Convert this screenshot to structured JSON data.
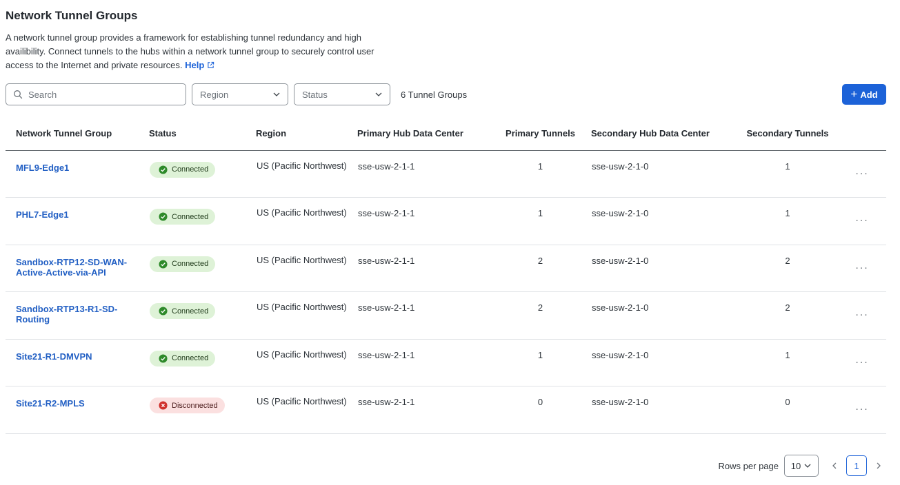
{
  "page": {
    "title": "Network Tunnel Groups",
    "description": "A network tunnel group provides a framework for establishing tunnel redundancy and high availibility. Connect tunnels to the hubs within a network tunnel group to securely control user access to the Internet and private resources.",
    "help_label": "Help"
  },
  "toolbar": {
    "search_placeholder": "Search",
    "region_placeholder": "Region",
    "status_placeholder": "Status",
    "count": "6 Tunnel Groups",
    "add_label": "Add"
  },
  "table": {
    "columns": [
      "Network Tunnel Group",
      "Status",
      "Region",
      "Primary Hub Data Center",
      "Primary Tunnels",
      "Secondary Hub Data Center",
      "Secondary Tunnels"
    ],
    "rows": [
      {
        "name": "MFL9-Edge1",
        "status": "Connected",
        "region": "US (Pacific Northwest)",
        "primary_hub": "sse-usw-2-1-1",
        "primary_tunnels": "1",
        "secondary_hub": "sse-usw-2-1-0",
        "secondary_tunnels": "1"
      },
      {
        "name": "PHL7-Edge1",
        "status": "Connected",
        "region": "US (Pacific Northwest)",
        "primary_hub": "sse-usw-2-1-1",
        "primary_tunnels": "1",
        "secondary_hub": "sse-usw-2-1-0",
        "secondary_tunnels": "1"
      },
      {
        "name": "Sandbox-RTP12-SD-WAN-Active-Active-via-API",
        "status": "Connected",
        "region": "US (Pacific Northwest)",
        "primary_hub": "sse-usw-2-1-1",
        "primary_tunnels": "2",
        "secondary_hub": "sse-usw-2-1-0",
        "secondary_tunnels": "2"
      },
      {
        "name": "Sandbox-RTP13-R1-SD-Routing",
        "status": "Connected",
        "region": "US (Pacific Northwest)",
        "primary_hub": "sse-usw-2-1-1",
        "primary_tunnels": "2",
        "secondary_hub": "sse-usw-2-1-0",
        "secondary_tunnels": "2"
      },
      {
        "name": "Site21-R1-DMVPN",
        "status": "Connected",
        "region": "US (Pacific Northwest)",
        "primary_hub": "sse-usw-2-1-1",
        "primary_tunnels": "1",
        "secondary_hub": "sse-usw-2-1-0",
        "secondary_tunnels": "1"
      },
      {
        "name": "Site21-R2-MPLS",
        "status": "Disconnected",
        "region": "US (Pacific Northwest)",
        "primary_hub": "sse-usw-2-1-1",
        "primary_tunnels": "0",
        "secondary_hub": "sse-usw-2-1-0",
        "secondary_tunnels": "0"
      }
    ],
    "row_action": "..."
  },
  "pagination": {
    "rows_per_page_label": "Rows per page",
    "rows_per_page_value": "10",
    "current_page": "1"
  },
  "colors": {
    "accent": "#1c62d8",
    "link": "#2360c4",
    "connected_bg": "#def2d7",
    "connected_icon": "#2e8a2a",
    "disconnected_bg": "#fbe0e0",
    "disconnected_icon": "#d0312d"
  },
  "icons": {
    "search": "search-icon",
    "external_link": "external-link-icon",
    "dropdown": "chevron-down-icon",
    "add": "plus-icon",
    "connected": "check-circle-icon",
    "disconnected": "x-circle-icon",
    "row_menu": "more-horizontal-icon",
    "prev": "chevron-left-icon",
    "next": "chevron-right-icon"
  }
}
